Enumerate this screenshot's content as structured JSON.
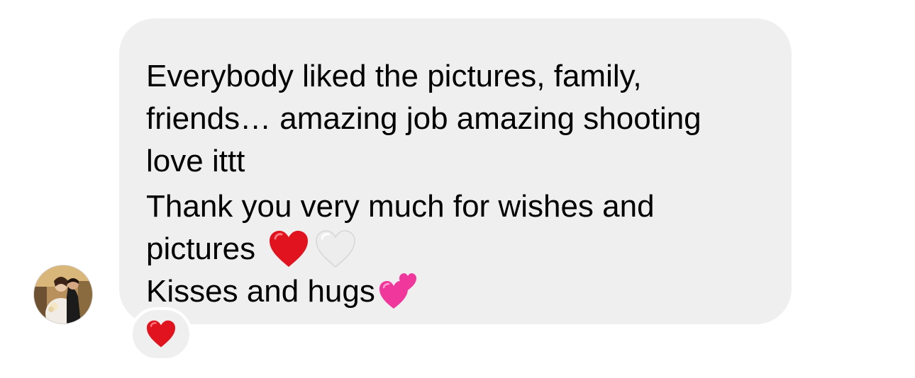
{
  "message": {
    "lines": [
      "Everybody liked the pictures, family,",
      "friends… amazing job amazing shooting",
      "love ittt",
      "Thank you very much for wishes and",
      "pictures",
      "Kisses and hugs"
    ]
  },
  "emojis": [
    "red-heart-icon",
    "white-heart-icon",
    "two-hearts-icon"
  ],
  "reaction": {
    "icon": "red-heart-icon"
  },
  "colors": {
    "bubble": "#efefef",
    "text": "#000000",
    "heart_red": "#e0131f",
    "heart_white": "#ededed",
    "hearts_pink": "#f0389c"
  }
}
